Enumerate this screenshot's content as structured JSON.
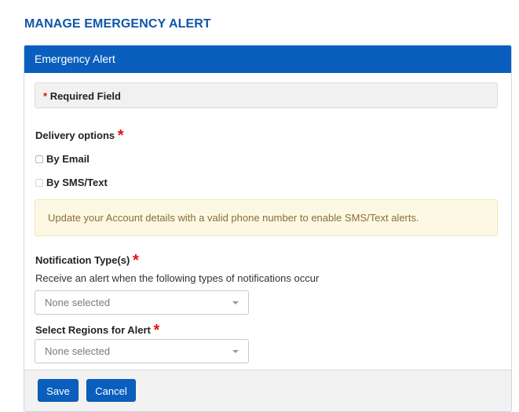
{
  "page": {
    "title": "MANAGE EMERGENCY ALERT"
  },
  "panel": {
    "header": "Emergency Alert",
    "required_marker": "*",
    "required_label": "Required Field"
  },
  "delivery": {
    "label": "Delivery options",
    "options": [
      {
        "label": "By Email",
        "checked": false,
        "enabled": true
      },
      {
        "label": "By SMS/Text",
        "checked": false,
        "enabled": false
      }
    ],
    "notice": "Update your Account details with a valid phone number to enable SMS/Text alerts."
  },
  "notification_types": {
    "label": "Notification Type(s)",
    "help": "Receive an alert when the following types of notifications occur",
    "selected": "None selected"
  },
  "regions": {
    "label": "Select Regions for Alert",
    "selected": "None selected"
  },
  "actions": {
    "save": "Save",
    "cancel": "Cancel"
  },
  "colors": {
    "primary": "#0a5fbe",
    "title": "#0f56a8",
    "required_star": "#e0140e",
    "notice_bg": "#fcf8e3",
    "notice_text": "#8a6d3b"
  }
}
